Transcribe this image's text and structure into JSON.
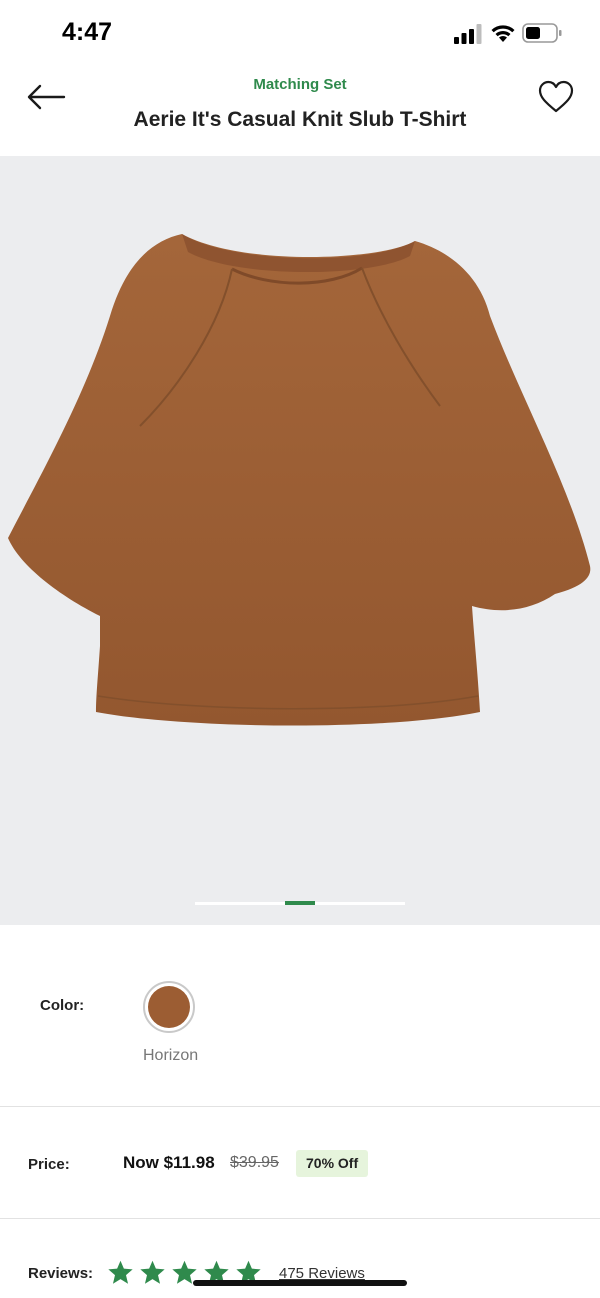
{
  "status_bar": {
    "time": "4:47",
    "icons": [
      "signal-icon",
      "wifi-icon",
      "battery-icon"
    ]
  },
  "header": {
    "subtitle": "Matching Set",
    "title": "Aerie It's Casual Knit Slub T-Shirt",
    "back_icon": "arrow-left-icon",
    "favorite_icon": "heart-outline-icon"
  },
  "gallery": {
    "image": "brown-tshirt-photo",
    "pages": 3,
    "active_page": 2
  },
  "color": {
    "label": "Color:",
    "selected": "Horizon",
    "swatch_color": "#9c5d33"
  },
  "price": {
    "label": "Price:",
    "now": "Now $11.98",
    "was": "$39.95",
    "discount": "70% Off"
  },
  "reviews": {
    "label": "Reviews:",
    "rating": 5,
    "max_rating": 5,
    "link_text": "475 Reviews"
  },
  "colors": {
    "accent": "#2f8a4c",
    "badge_bg": "#e6f4dc",
    "star": "#2f8a4c"
  }
}
